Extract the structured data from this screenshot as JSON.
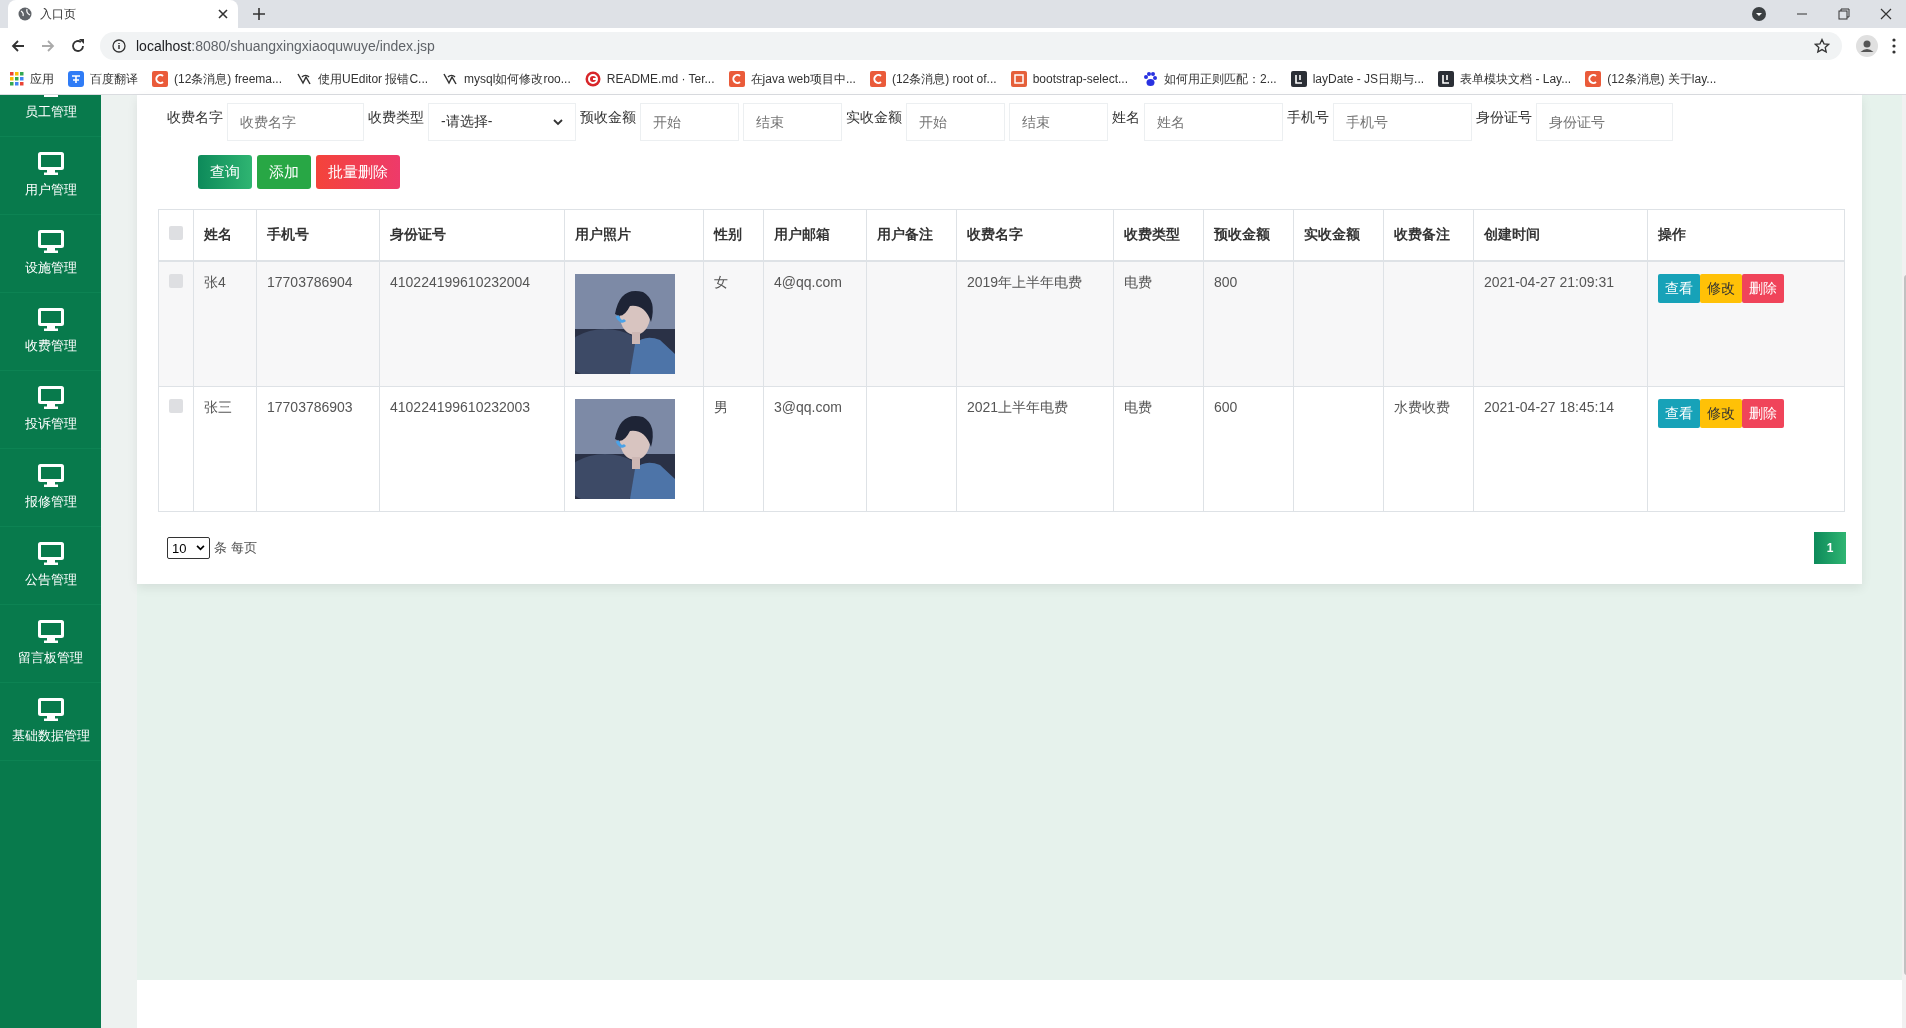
{
  "browser": {
    "tab_title": "入口页",
    "url_host": "localhost",
    "url_rest": ":8080/shuangxingxiaoquwuye/index.jsp",
    "bookmarks": [
      {
        "label": "应用",
        "kind": "grid"
      },
      {
        "label": "百度翻译",
        "kind": "blue"
      },
      {
        "label": "(12条消息) freema...",
        "kind": "red"
      },
      {
        "label": "使用UEditor 报错C...",
        "kind": "bird"
      },
      {
        "label": "mysql如何修改roo...",
        "kind": "bird"
      },
      {
        "label": "README.md · Ter...",
        "kind": "ring"
      },
      {
        "label": "在java web项目中...",
        "kind": "red"
      },
      {
        "label": "(12条消息) root of...",
        "kind": "red"
      },
      {
        "label": "bootstrap-select...",
        "kind": "orange"
      },
      {
        "label": "如何用正则匹配：2...",
        "kind": "paw"
      },
      {
        "label": "layDate - JS日期与...",
        "kind": "dark"
      },
      {
        "label": "表单模块文档 - Lay...",
        "kind": "dark"
      },
      {
        "label": "(12条消息) 关于lay...",
        "kind": "red"
      }
    ]
  },
  "sidebar": {
    "items": [
      {
        "label": "员工管理"
      },
      {
        "label": "用户管理"
      },
      {
        "label": "设施管理"
      },
      {
        "label": "收费管理"
      },
      {
        "label": "投诉管理"
      },
      {
        "label": "报修管理"
      },
      {
        "label": "公告管理"
      },
      {
        "label": "留言板管理"
      },
      {
        "label": "基础数据管理"
      }
    ]
  },
  "filters": [
    {
      "label": "收费名字",
      "fields": [
        {
          "kind": "input",
          "placeholder": "收费名字"
        }
      ]
    },
    {
      "label": "收费类型",
      "fields": [
        {
          "kind": "select",
          "value": "-请选择-"
        }
      ]
    },
    {
      "label": "预收金额",
      "fields": [
        {
          "kind": "input",
          "placeholder": "开始"
        },
        {
          "kind": "input",
          "placeholder": "结束"
        }
      ]
    },
    {
      "label": "实收金额",
      "fields": [
        {
          "kind": "input",
          "placeholder": "开始"
        },
        {
          "kind": "input",
          "placeholder": "结束"
        }
      ]
    },
    {
      "label": "姓名",
      "fields": [
        {
          "kind": "input",
          "placeholder": "姓名"
        }
      ]
    },
    {
      "label": "手机号",
      "fields": [
        {
          "kind": "input",
          "placeholder": "手机号"
        }
      ]
    },
    {
      "label": "身份证号",
      "fields": [
        {
          "kind": "input",
          "placeholder": "身份证号"
        }
      ]
    }
  ],
  "actions": [
    {
      "label": "查询",
      "kind": "search"
    },
    {
      "label": "添加",
      "kind": "add"
    },
    {
      "label": "批量删除",
      "kind": "delete"
    }
  ],
  "table": {
    "select_all_checked": false,
    "columns": [
      "姓名",
      "手机号",
      "身份证号",
      "用户照片",
      "性别",
      "用户邮箱",
      "用户备注",
      "收费名字",
      "收费类型",
      "预收金额",
      "实收金额",
      "收费备注",
      "创建时间",
      "操作"
    ],
    "rows": [
      {
        "checked": false,
        "cells": [
          "张4",
          "17703786904",
          "410224199610232004",
          null,
          "女",
          "4@qq.com",
          "",
          "2019年上半年电费",
          "电费",
          "800",
          "",
          "",
          "2021-04-27 21:09:31"
        ],
        "buttons": [
          {
            "label": "查看",
            "kind": "view"
          },
          {
            "label": "修改",
            "kind": "edit"
          },
          {
            "label": "删除",
            "kind": "delete"
          }
        ]
      },
      {
        "checked": false,
        "cells": [
          "张三",
          "17703786903",
          "410224199610232003",
          null,
          "男",
          "3@qq.com",
          "",
          "2021上半年电费",
          "电费",
          "600",
          "",
          "水费收费",
          "2021-04-27 18:45:14"
        ],
        "buttons": [
          {
            "label": "查看",
            "kind": "view"
          },
          {
            "label": "修改",
            "kind": "edit"
          },
          {
            "label": "删除",
            "kind": "delete"
          }
        ]
      }
    ]
  },
  "pagination": {
    "page_size": "10",
    "page_size_label": "条 每页",
    "pages": [
      {
        "label": "1",
        "selected": true
      }
    ]
  }
}
